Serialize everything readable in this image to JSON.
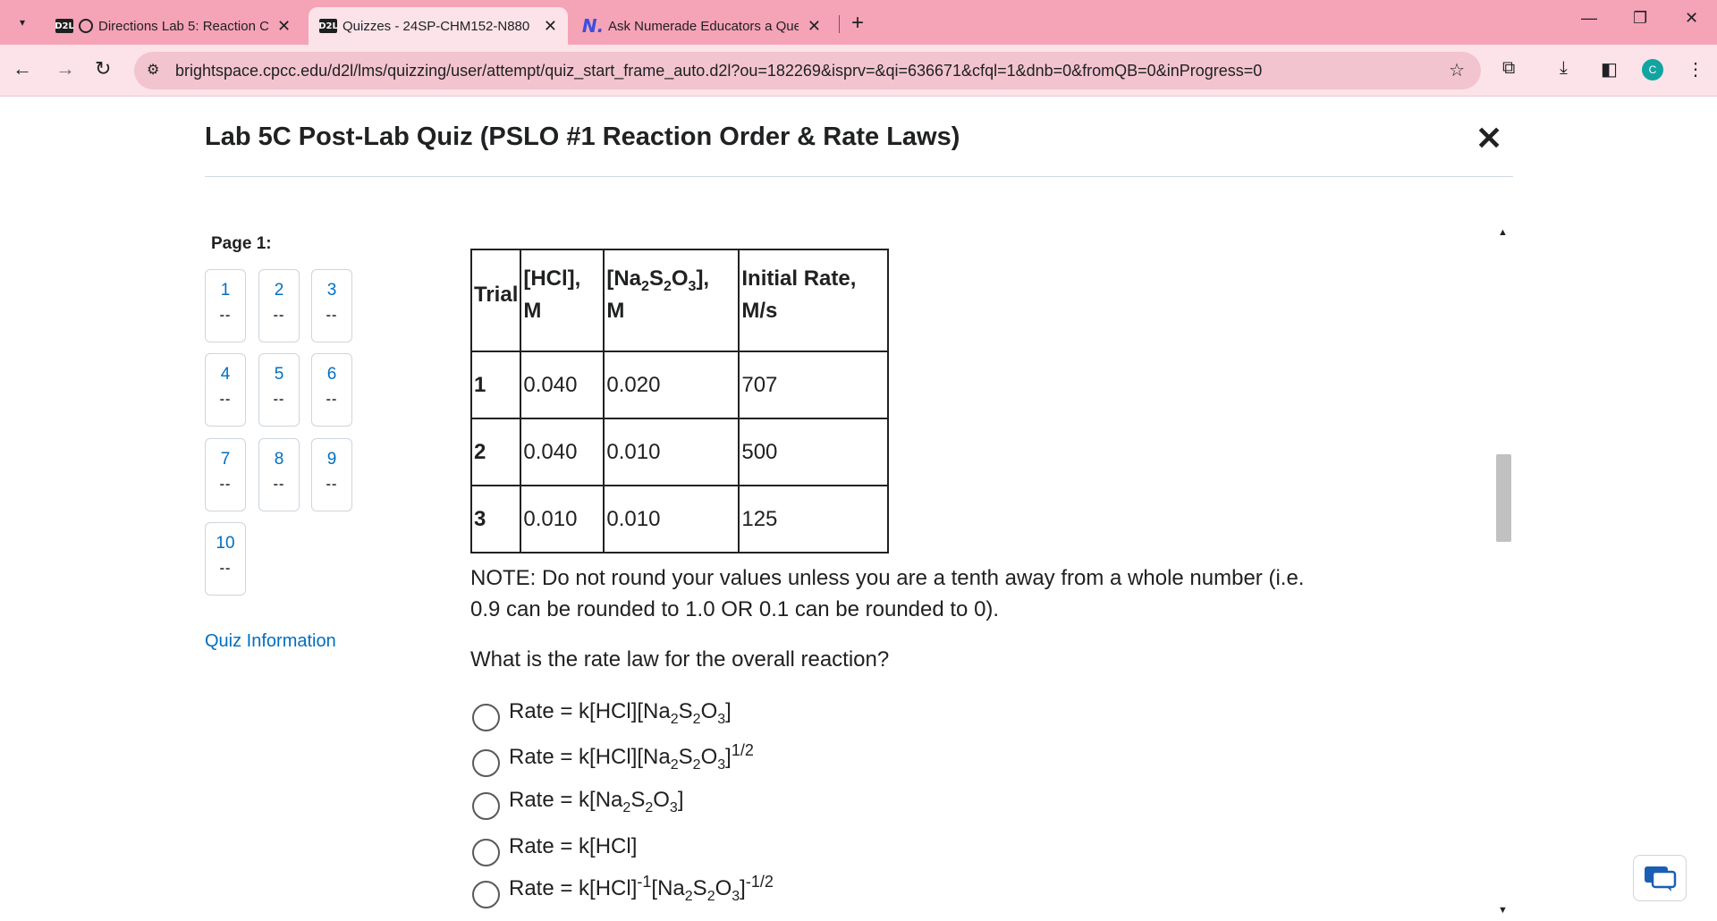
{
  "browser": {
    "tabs": [
      {
        "favicon": "D2L",
        "title": "Directions Lab 5: Reaction C",
        "close": "✕"
      },
      {
        "favicon": "D2L",
        "title": "Quizzes - 24SP-CHM152-N880",
        "close": "✕"
      },
      {
        "favicon": "N.",
        "title": "Ask Numerade Educators a Que",
        "close": "✕"
      }
    ],
    "new_tab": "+",
    "url": "brightspace.cpcc.edu/d2l/lms/quizzing/user/attempt/quiz_start_frame_auto.d2l?ou=182269&isprv=&qi=636671&cfql=1&dnb=0&fromQB=0&inProgress=0",
    "profile_initial": "C"
  },
  "quiz": {
    "title": "Lab 5C Post-Lab Quiz (PSLO #1 Reaction Order & Rate Laws)",
    "close": "✕",
    "page_label": "Page 1:",
    "questions": [
      {
        "num": "1",
        "status": "--"
      },
      {
        "num": "2",
        "status": "--"
      },
      {
        "num": "3",
        "status": "--"
      },
      {
        "num": "4",
        "status": "--"
      },
      {
        "num": "5",
        "status": "--"
      },
      {
        "num": "6",
        "status": "--"
      },
      {
        "num": "7",
        "status": "--"
      },
      {
        "num": "8",
        "status": "--"
      },
      {
        "num": "9",
        "status": "--"
      },
      {
        "num": "10",
        "status": "--"
      }
    ],
    "quiz_info_link": "Quiz Information",
    "table": {
      "headers": [
        "Trial",
        "[HCl], M",
        "[Na2S2O3], M",
        "Initial Rate, M/s"
      ],
      "rows": [
        [
          "1",
          "0.040",
          "0.020",
          "707"
        ],
        [
          "2",
          "0.040",
          "0.010",
          "500"
        ],
        [
          "3",
          "0.010",
          "0.010",
          "125"
        ]
      ]
    },
    "note": "NOTE: Do not round your values unless you are a tenth away from a whole number (i.e. 0.9 can be rounded to 1.0 OR 0.1 can be rounded to 0).",
    "question": "What is the rate law for the overall reaction?",
    "choice_prefix": "Rate = k",
    "choices": [
      "Rate = k[HCl][Na2S2O3]",
      "Rate = k[HCl][Na2S2O3]1/2",
      "Rate = k[Na2S2O3]",
      "Rate = k[HCl]",
      "Rate = k[HCl]-1[Na2S2O3]-1/2"
    ]
  }
}
